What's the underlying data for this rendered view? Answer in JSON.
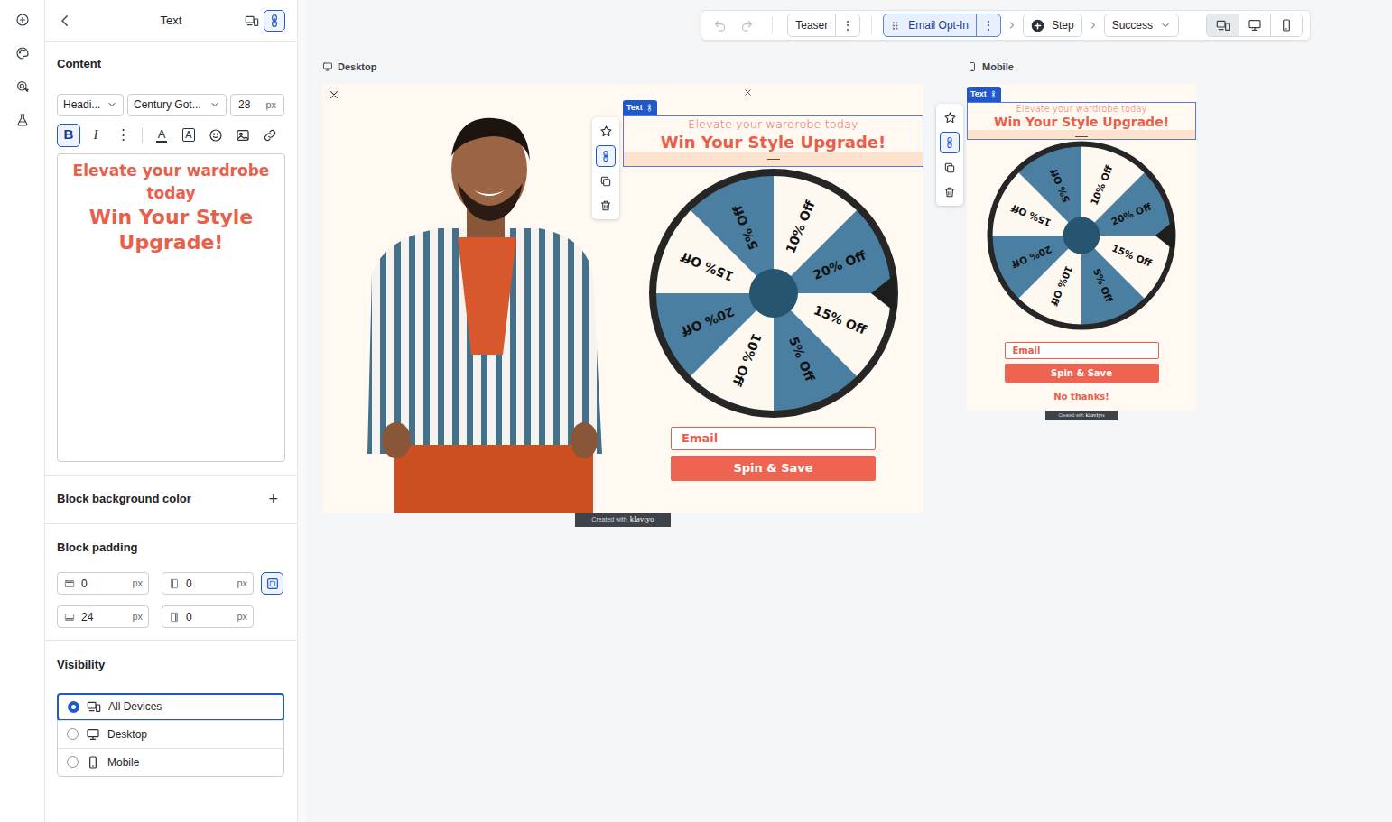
{
  "panel": {
    "title": "Text",
    "header_toggles": [
      {
        "kind": "all-devices",
        "selected": false
      },
      {
        "kind": "linked",
        "selected": true
      }
    ],
    "content_label": "Content",
    "style_select": "Headi...",
    "font_select": "Century Got...",
    "font_size": "28",
    "font_size_unit": "px",
    "format_buttons": [
      {
        "label": "B",
        "selected": true
      },
      {
        "label": "I",
        "selected": false
      },
      {
        "label": "⋮",
        "selected": false
      }
    ],
    "color_buttons": [
      {
        "label": "A",
        "kind": "text-color"
      },
      {
        "label": "A",
        "kind": "highlight"
      }
    ],
    "editor": {
      "subtitle": "Elevate your wardrobe today",
      "title": "Win Your Style Upgrade!"
    },
    "background": {
      "label": "Block background color",
      "add": "+"
    },
    "padding": {
      "label": "Block padding",
      "linked": true,
      "fields": [
        {
          "kind": "top",
          "value": "0",
          "unit": "px"
        },
        {
          "kind": "left",
          "value": "0",
          "unit": "px"
        },
        {
          "kind": "bottom",
          "value": "24",
          "unit": "px"
        },
        {
          "kind": "right",
          "value": "0",
          "unit": "px"
        }
      ]
    },
    "visibility": {
      "label": "Visibility",
      "options": [
        {
          "label": "All Devices",
          "kind": "all",
          "selected": true
        },
        {
          "label": "Desktop",
          "kind": "desktop",
          "selected": false
        },
        {
          "label": "Mobile",
          "kind": "mobile",
          "selected": false
        }
      ]
    }
  },
  "toolbar": {
    "history": [
      {
        "kind": "undo",
        "disabled": true
      },
      {
        "kind": "redo",
        "disabled": true
      }
    ],
    "steps": [
      {
        "label": "Teaser",
        "kind": "step",
        "menu": "⋮",
        "selected": false
      },
      {
        "label": "Email Opt-In",
        "kind": "step",
        "menu": "⋮",
        "selected": true
      },
      {
        "label": "Step",
        "kind": "add",
        "selected": false
      },
      {
        "label": "Success",
        "kind": "dropdown",
        "selected": false
      }
    ],
    "view_modes": [
      {
        "kind": "both",
        "selected": true
      },
      {
        "kind": "desktop",
        "selected": false
      },
      {
        "kind": "mobile",
        "selected": false
      }
    ]
  },
  "previews": [
    {
      "kind": "desktop",
      "label": "Desktop",
      "block_tag": "Text",
      "subtitle": "Elevate your wardrobe today",
      "title": "Win Your Style Upgrade!",
      "segments": [
        {
          "label": "10% Off",
          "color": "#fdf8f0"
        },
        {
          "label": "20% Off",
          "color": "#4b7fa1"
        },
        {
          "label": "15% Off",
          "color": "#fdf8f0"
        },
        {
          "label": "5% Off",
          "color": "#4b7fa1"
        },
        {
          "label": "10% Off",
          "color": "#fdf8f0"
        },
        {
          "label": "20% Off",
          "color": "#4b7fa1"
        },
        {
          "label": "15% Off",
          "color": "#fdf8f0"
        },
        {
          "label": "5% Off",
          "color": "#4b7fa1"
        }
      ],
      "email_placeholder": "Email",
      "button": "Spin & Save",
      "badge": {
        "prefix": "Created with",
        "brand": "klaviyo"
      }
    },
    {
      "kind": "mobile",
      "label": "Mobile",
      "block_tag": "Text",
      "subtitle": "Elevate your wardrobe today",
      "title": "Win Your Style Upgrade!",
      "segments": [
        {
          "label": "10% Off",
          "color": "#fdf8f0"
        },
        {
          "label": "20% Off",
          "color": "#4b7fa1"
        },
        {
          "label": "15% Off",
          "color": "#fdf8f0"
        },
        {
          "label": "5% Off",
          "color": "#4b7fa1"
        },
        {
          "label": "10% Off",
          "color": "#fdf8f0"
        },
        {
          "label": "20% Off",
          "color": "#4b7fa1"
        },
        {
          "label": "15% Off",
          "color": "#fdf8f0"
        },
        {
          "label": "5% Off",
          "color": "#4b7fa1"
        }
      ],
      "email_placeholder": "Email",
      "button": "Spin & Save",
      "decline": "No thanks!",
      "badge": {
        "prefix": "Created with",
        "brand": "klaviyo"
      }
    }
  ]
}
